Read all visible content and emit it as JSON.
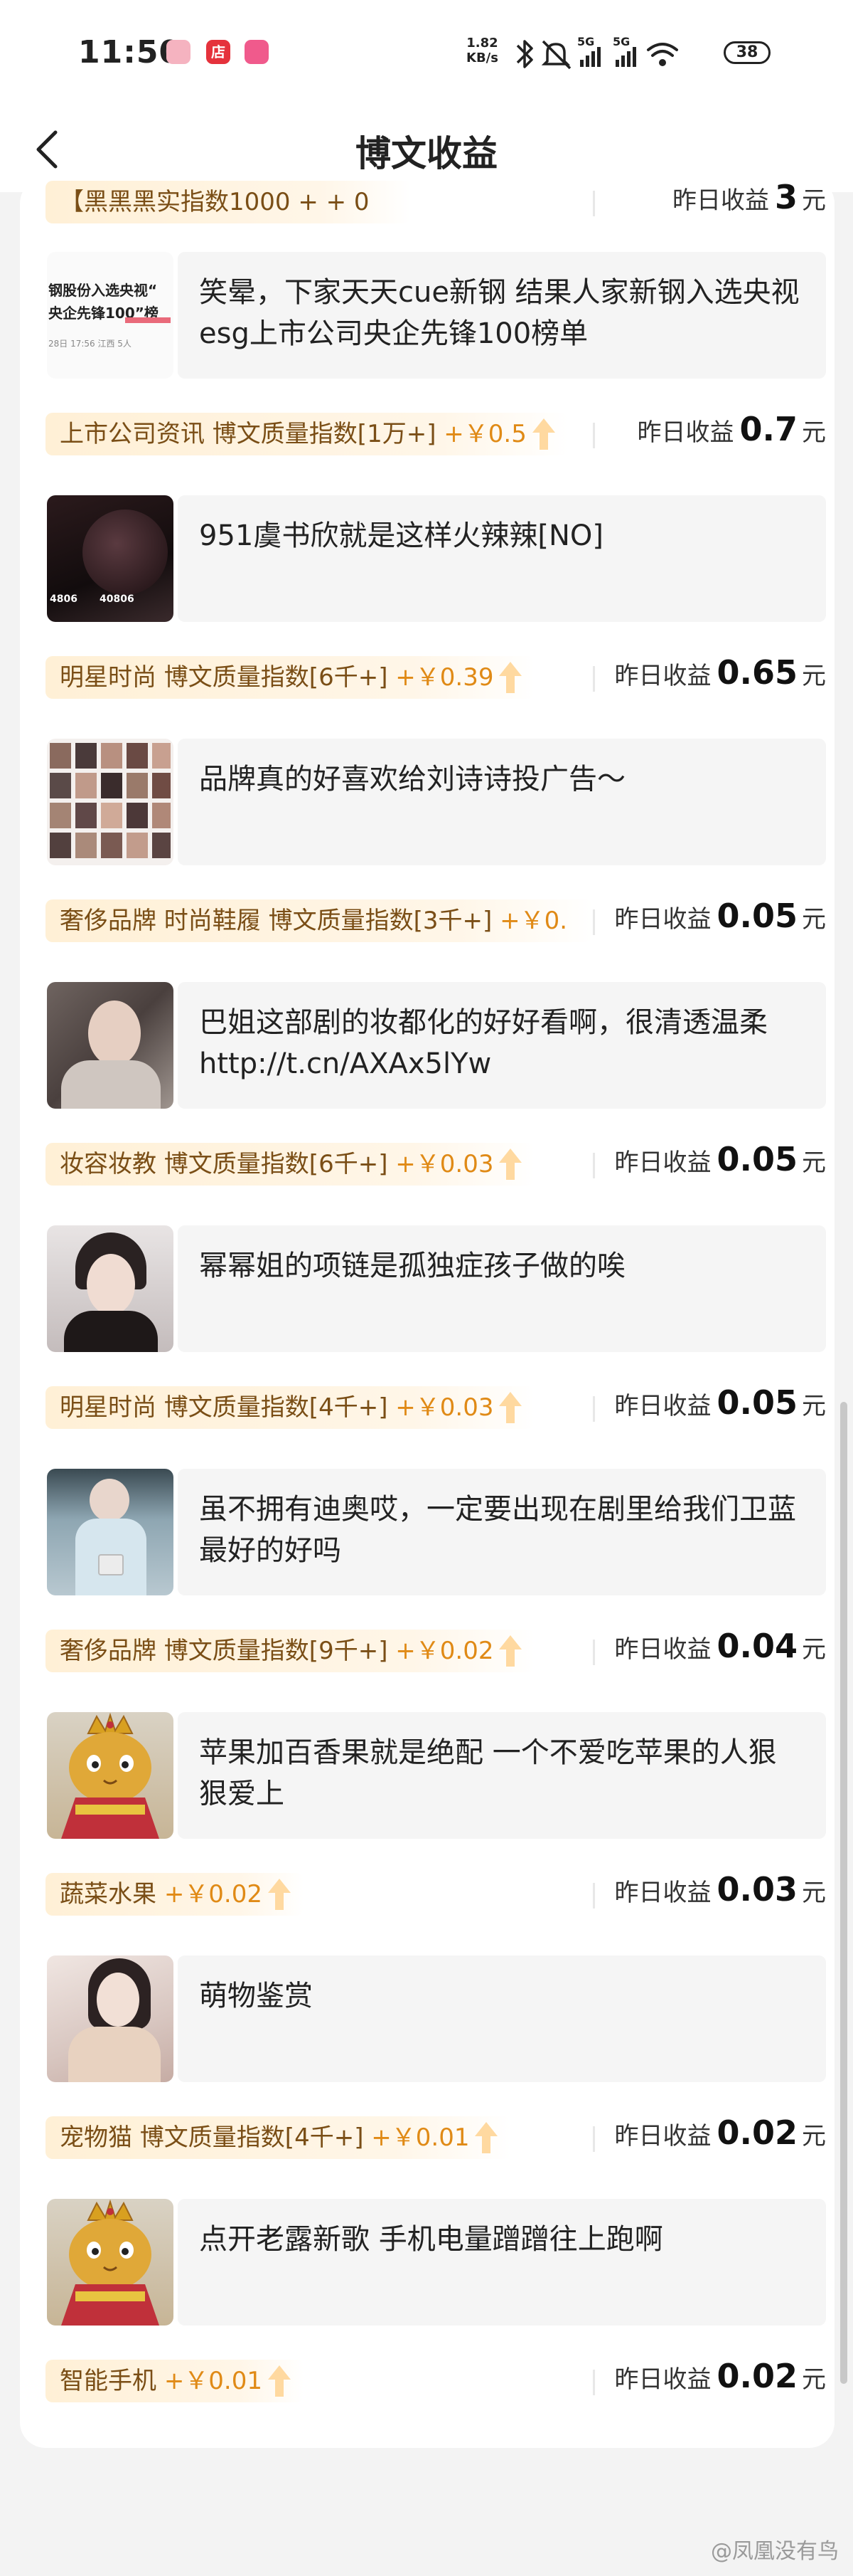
{
  "status_bar": {
    "time": "11:50",
    "app_badge_shop": "店",
    "net_speed_value": "1.82",
    "net_speed_unit": "KB/s",
    "signal_1": "5G",
    "signal_2": "5G",
    "battery": "38"
  },
  "nav": {
    "title": "博文收益"
  },
  "top_partial": {
    "tag": "【黑黑黑实指数1000 + + 0",
    "earn_label": "昨日收益",
    "earn_value": "3",
    "earn_unit": "元"
  },
  "posts": [
    {
      "text": "笑晕，下家天天cue新钢 结果人家新钢入选央视esg上市公司央企先锋100榜单",
      "thumb_icon": "news-screenshot-thumbnail",
      "thumb_caption_1": "钢股份入选央视“",
      "thumb_caption_2": "央企先锋100”榜",
      "thumb_caption_3": "28日 17:56  江西  5人",
      "tag_category": "上市公司资讯 博文质量指数[1万+]",
      "tag_plus": "+￥0.5",
      "earn_label": "昨日收益",
      "earn_value": "0.7",
      "earn_unit": "元"
    },
    {
      "text": "951虞书欣就是这样火辣辣[NO]",
      "thumb_icon": "stage-photo-thumbnail",
      "thumb_caption_1": "4806",
      "thumb_caption_2": "40806",
      "tag_category": "明星时尚 博文质量指数[6千+]",
      "tag_plus": "+￥0.39",
      "earn_label": "昨日收益",
      "earn_value": "0.65",
      "earn_unit": "元"
    },
    {
      "text": "品牌真的好喜欢给刘诗诗投广告～",
      "thumb_icon": "photo-grid-thumbnail",
      "tag_category": "奢侈品牌 时尚鞋履 博文质量指数[3千+]",
      "tag_plus": "+￥0.",
      "earn_label": "昨日收益",
      "earn_value": "0.05",
      "earn_unit": "元"
    },
    {
      "text": "巴姐这部剧的妆都化的好好看啊，很清透温柔 http://t.cn/AXAx5lYw",
      "thumb_icon": "portrait-thumbnail",
      "tag_category": "妆容妆教 博文质量指数[6千+]",
      "tag_plus": "+￥0.03",
      "earn_label": "昨日收益",
      "earn_value": "0.05",
      "earn_unit": "元"
    },
    {
      "text": "幂幂姐的项链是孤独症孩子做的唉",
      "thumb_icon": "portrait-thumbnail",
      "tag_category": "明星时尚 博文质量指数[4千+]",
      "tag_plus": "+￥0.03",
      "earn_label": "昨日收益",
      "earn_value": "0.05",
      "earn_unit": "元"
    },
    {
      "text": "虽不拥有迪奥哎，一定要出现在剧里给我们卫蓝最好的好吗",
      "thumb_icon": "fashion-photo-thumbnail",
      "tag_category": "奢侈品牌 博文质量指数[9千+]",
      "tag_plus": "+￥0.02",
      "earn_label": "昨日收益",
      "earn_value": "0.04",
      "earn_unit": "元"
    },
    {
      "text": "苹果加百香果就是绝配 一个不爱吃苹果的人狠狠爱上",
      "thumb_icon": "cat-king-avatar-thumbnail",
      "tag_category": "蔬菜水果",
      "tag_plus": "+￥0.02",
      "earn_label": "昨日收益",
      "earn_value": "0.03",
      "earn_unit": "元"
    },
    {
      "text": "萌物鉴赏",
      "thumb_icon": "portrait-thumbnail",
      "tag_category": "宠物猫 博文质量指数[4千+]",
      "tag_plus": "+￥0.01",
      "earn_label": "昨日收益",
      "earn_value": "0.02",
      "earn_unit": "元"
    },
    {
      "text": "点开老露新歌 手机电量蹭蹭往上跑啊",
      "thumb_icon": "cat-king-avatar-thumbnail",
      "tag_category": "智能手机",
      "tag_plus": "+￥0.01",
      "earn_label": "昨日收益",
      "earn_value": "0.02",
      "earn_unit": "元"
    }
  ],
  "watermark": "@凤凰没有鸟",
  "colors": {
    "accent_orange": "#e08a16",
    "tag_text": "#7a4e16",
    "tag_bg": "#fff0d6",
    "bubble_bg": "#f5f5f5"
  }
}
